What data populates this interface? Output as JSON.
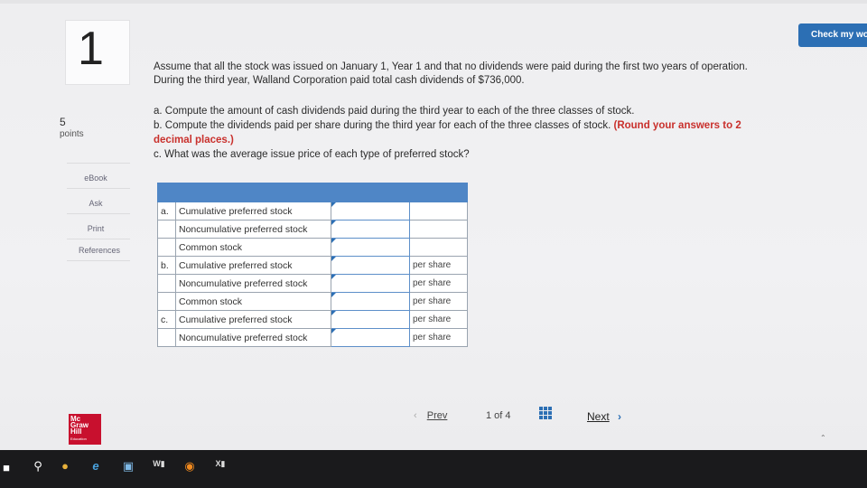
{
  "header": {
    "check_button": "Check my wo"
  },
  "question": {
    "number": "1",
    "points_value": "5",
    "points_label": "points",
    "intro_line1": "Assume that all the stock was issued on January 1, Year 1 and that no dividends were paid during the first two years of operation.",
    "intro_line2": "During the third year, Walland Corporation paid total cash dividends of $736,000.",
    "part_a": "a. Compute the amount of cash dividends paid during the third year to each of the three classes of stock.",
    "part_b": "b. Compute the dividends paid per share during the third year for each of the three classes of stock.",
    "part_b_note_1": "(Round your answers to 2",
    "part_b_note_2": "decimal places.)",
    "part_c": "c. What was the average issue price of each type of preferred stock?"
  },
  "sidebar": {
    "ebook": "eBook",
    "ask": "Ask",
    "print": "Print",
    "references": "References"
  },
  "table": {
    "rows": [
      {
        "letter": "a.",
        "label": "Cumulative preferred stock",
        "value": "",
        "unit": ""
      },
      {
        "letter": "",
        "label": "Noncumulative preferred stock",
        "value": "",
        "unit": ""
      },
      {
        "letter": "",
        "label": "Common stock",
        "value": "",
        "unit": ""
      },
      {
        "letter": "b.",
        "label": "Cumulative preferred stock",
        "value": "",
        "unit": "per share"
      },
      {
        "letter": "",
        "label": "Noncumulative preferred stock",
        "value": "",
        "unit": "per share"
      },
      {
        "letter": "",
        "label": "Common stock",
        "value": "",
        "unit": "per share"
      },
      {
        "letter": "c.",
        "label": "Cumulative preferred stock",
        "value": "",
        "unit": "per share"
      },
      {
        "letter": "",
        "label": "Noncumulative preferred stock",
        "value": "",
        "unit": "per share"
      }
    ]
  },
  "pager": {
    "prev": "Prev",
    "position": "1 of 4",
    "next": "Next"
  },
  "logo": {
    "line1": "Mc",
    "line2": "Graw",
    "line3": "Hill",
    "line4": "Education"
  },
  "colors": {
    "accent": "#2c6fb4",
    "header_row": "#4f86c6",
    "warning": "#c9302c",
    "taskbar": "#1a1a1c"
  },
  "taskbar": {
    "icons": [
      "start-icon",
      "search-icon",
      "chrome-icon",
      "edge-icon",
      "store-icon",
      "word-icon",
      "firefox-icon",
      "excel-icon"
    ]
  }
}
